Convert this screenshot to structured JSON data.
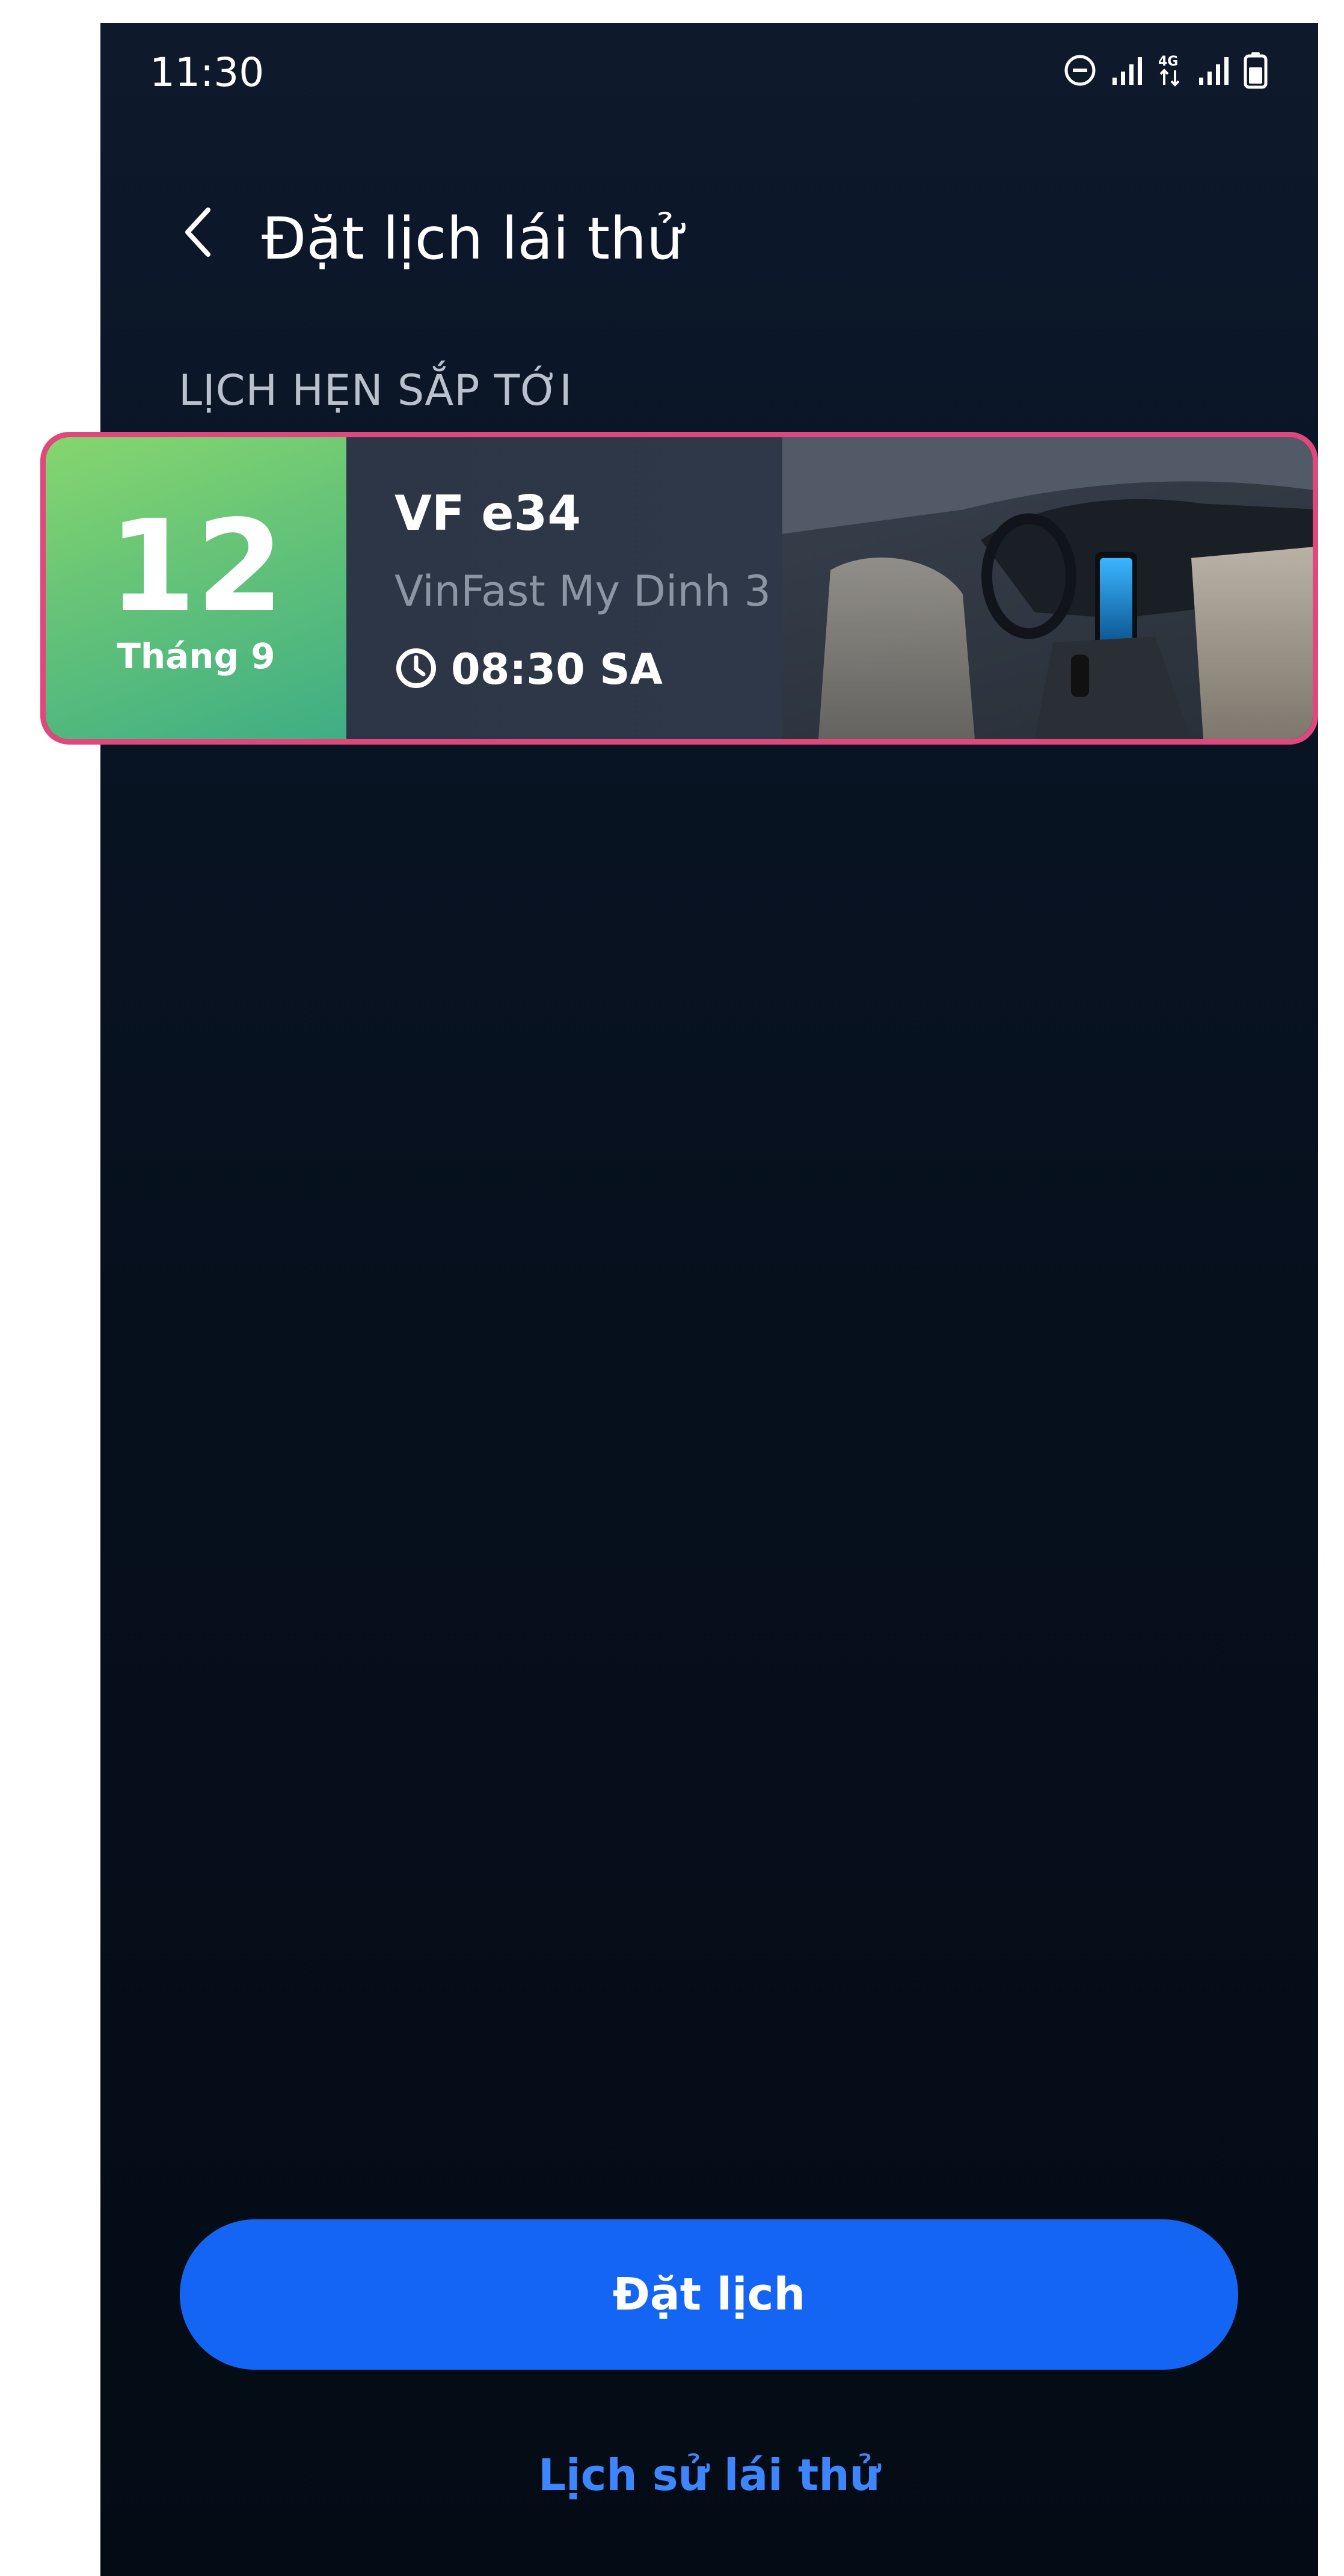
{
  "status_bar": {
    "time": "11:30",
    "icons": [
      "do-not-disturb-icon",
      "signal-icon",
      "4g-data-icon",
      "signal-icon",
      "battery-icon"
    ]
  },
  "header": {
    "back_icon": "chevron-left-icon",
    "title": "Đặt lịch lái thử"
  },
  "upcoming": {
    "section_label": "LỊCH HẸN SẮP TỚI",
    "appointments": [
      {
        "day": "12",
        "month": "Tháng 9",
        "model": "VF e34",
        "dealer": "VinFast My Dinh 3",
        "time": "08:30 SA",
        "time_icon": "clock-icon"
      }
    ]
  },
  "actions": {
    "book_label": "Đặt lịch",
    "history_label": "Lịch sử lái thử"
  },
  "colors": {
    "background": "#06101d",
    "accent_blue": "#1565f5",
    "link_blue": "#3d86ff",
    "date_green": "#5dbf7a",
    "highlight_pink": "#e0477d"
  }
}
